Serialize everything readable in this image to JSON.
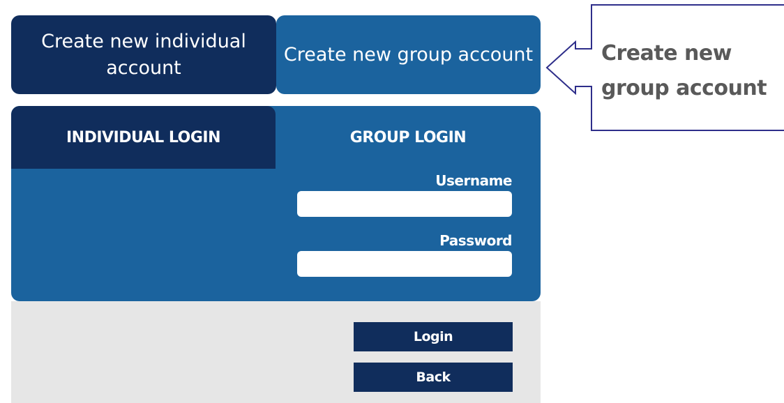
{
  "create_buttons": {
    "individual_label": "Create new individual account",
    "group_label": "Create new group account"
  },
  "login_tabs": {
    "individual_label": "INDIVIDUAL LOGIN",
    "group_label": "GROUP LOGIN",
    "active": "group"
  },
  "form": {
    "username_label": "Username",
    "username_value": "",
    "password_label": "Password",
    "password_value": ""
  },
  "actions": {
    "login_label": "Login",
    "back_label": "Back"
  },
  "callout": {
    "text": "Create new group account"
  },
  "colors": {
    "dark_navy": "#102d5c",
    "medium_blue": "#1b639e",
    "grey_area": "#e6e6e6",
    "callout_stroke": "#2e2e8a",
    "callout_text": "#595959"
  }
}
